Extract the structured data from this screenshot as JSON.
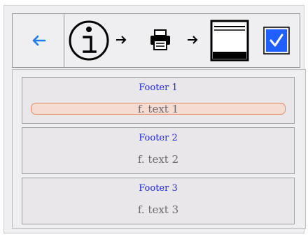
{
  "toolbar": {
    "icons": [
      "back-arrow-icon",
      "info-icon",
      "arrow-right-icon",
      "printer-icon",
      "arrow-right-icon",
      "print-preview-icon",
      "checkbox-icon"
    ],
    "checkbox_checked": true,
    "accent": "#1f5fff"
  },
  "sections": [
    {
      "title": "Footer 1",
      "text": "f. text 1",
      "focused": true
    },
    {
      "title": "Footer 2",
      "text": "f. text 2",
      "focused": false
    },
    {
      "title": "Footer 3",
      "text": "f. text 3",
      "focused": false
    }
  ],
  "colors": {
    "title": "#1f27f0",
    "text": "#6c6a6e",
    "focus_border": "#e58a62",
    "focus_fill": "#f4dcd3"
  }
}
